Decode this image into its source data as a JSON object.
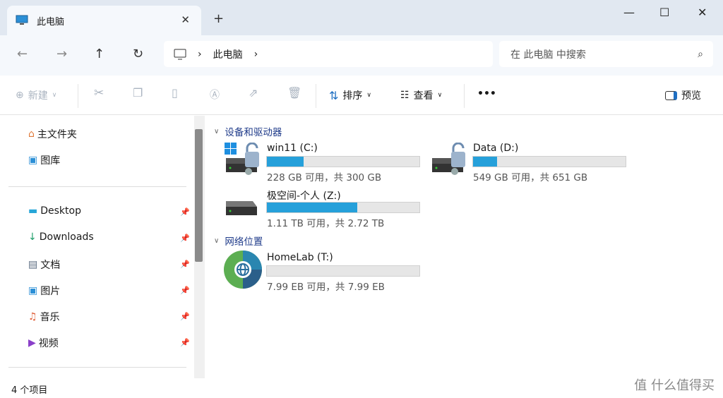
{
  "window": {
    "tab_title": "此电脑",
    "close_tab": "✕",
    "new_tab": "+",
    "minimize": "—",
    "maximize": "☐",
    "close": "✕"
  },
  "address": {
    "segment": "此电脑",
    "search_placeholder": "在 此电脑 中搜索"
  },
  "toolbar": {
    "new": "新建",
    "sort": "排序",
    "view": "查看",
    "more": "•••",
    "preview": "预览"
  },
  "sidebar": {
    "top": [
      {
        "label": "主文件夹"
      },
      {
        "label": "图库"
      }
    ],
    "pinned": [
      {
        "label": "Desktop"
      },
      {
        "label": "Downloads"
      },
      {
        "label": "文档"
      },
      {
        "label": "图片"
      },
      {
        "label": "音乐"
      },
      {
        "label": "视频"
      }
    ]
  },
  "groups": [
    {
      "title": "设备和驱动器",
      "drives": [
        {
          "name": "win11 (C:)",
          "size": "228 GB 可用，共 300 GB",
          "used_fraction": 0.24
        },
        {
          "name": "Data (D:)",
          "size": "549 GB 可用，共 651 GB",
          "used_fraction": 0.157
        },
        {
          "name": "极空间-个人 (Z:)",
          "size": "1.11 TB 可用，共 2.72 TB",
          "used_fraction": 0.592
        }
      ]
    },
    {
      "title": "网络位置",
      "drives": [
        {
          "name": "HomeLab (T:)",
          "size": "7.99 EB 可用，共 7.99 EB",
          "used_fraction": 0.0
        }
      ]
    }
  ],
  "status": {
    "count": "4 个项目"
  },
  "watermark": "值 什么值得买",
  "colors": {
    "accent": "#26a0da"
  }
}
